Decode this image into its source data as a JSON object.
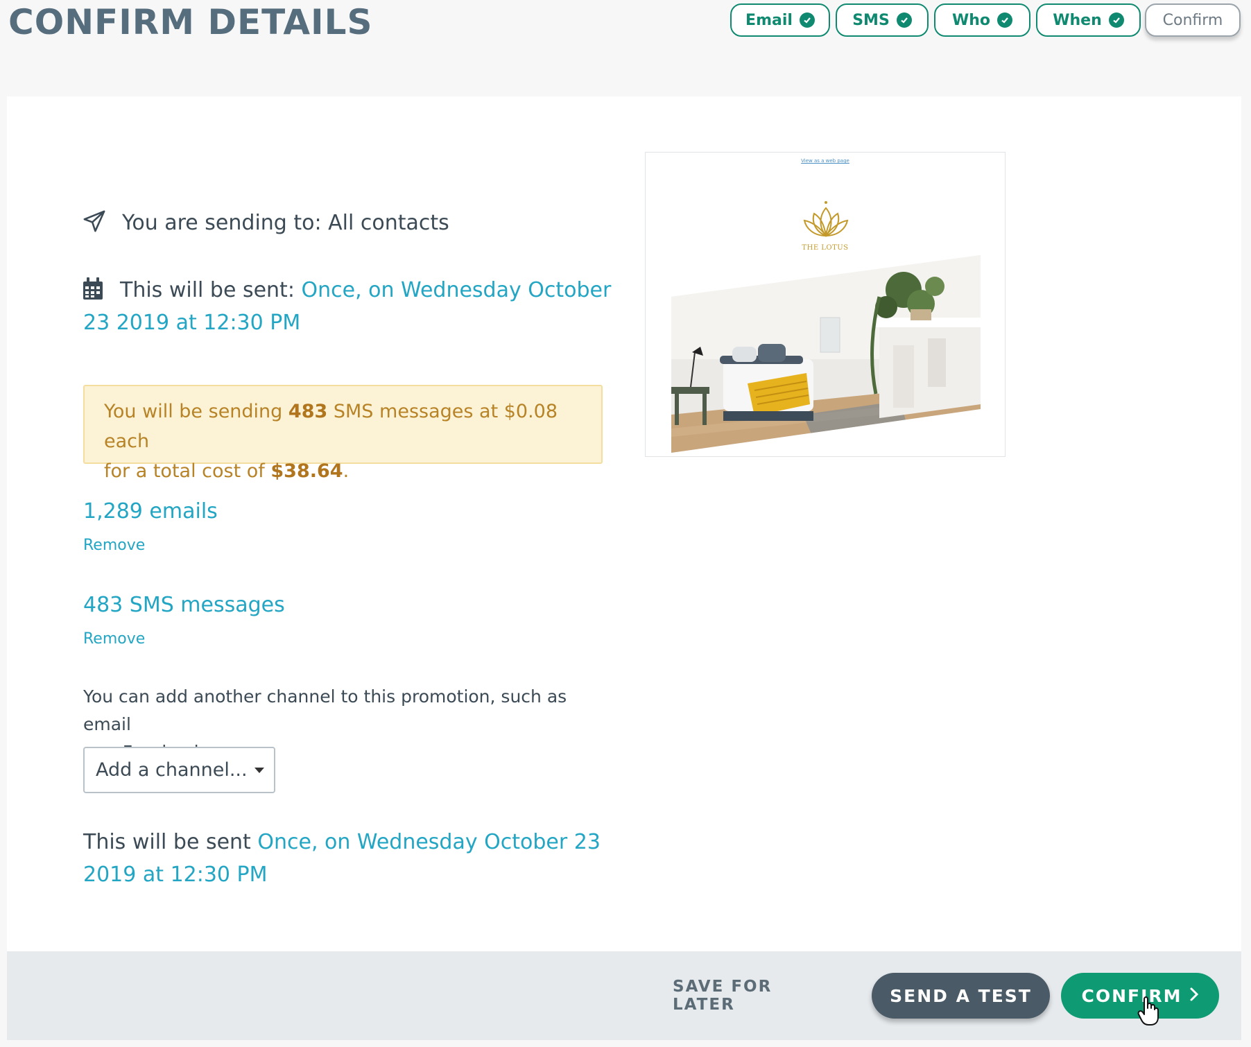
{
  "header": {
    "title": "CONFIRM DETAILS",
    "steps": [
      {
        "label": "Email",
        "done": true
      },
      {
        "label": "SMS",
        "done": true
      },
      {
        "label": "Who",
        "done": true
      },
      {
        "label": "When",
        "done": true
      },
      {
        "label": "Confirm",
        "done": false
      }
    ]
  },
  "summary": {
    "sending_to": "You are sending to: All contacts",
    "sent_label": "This will be sent:",
    "sent_schedule_line1": "Once, on Wednesday October",
    "sent_schedule_line2": "23 2019 at 12:30 PM"
  },
  "notice": {
    "prefix": "You will be sending",
    "count": "483",
    "mid": "SMS messages at $0.08 each",
    "line2_prefix": "for a total cost of",
    "total": "$38.64",
    "suffix": "."
  },
  "channels": [
    {
      "label": "1,289 emails",
      "remove": "Remove"
    },
    {
      "label": "483 SMS messages",
      "remove": "Remove"
    }
  ],
  "add_channel": {
    "help_line1": "You can add another channel to this promotion, such as email",
    "help_line2": "or a Facebook:",
    "selected": "Add a channel..."
  },
  "bottom_schedule": {
    "label": "This will be sent",
    "line1": "Once, on Wednesday October 23",
    "line2": "2019 at 12:30 PM"
  },
  "preview": {
    "web_link": "View as a web page",
    "brand": "THE LOTUS"
  },
  "footer": {
    "save_later": "SAVE FOR LATER",
    "send_test": "SEND A TEST",
    "confirm": "CONFIRM"
  },
  "colors": {
    "accent": "#23a5c4",
    "success": "#0e9b73",
    "title": "#566d7d",
    "notice_bg": "#fcf3d7"
  }
}
